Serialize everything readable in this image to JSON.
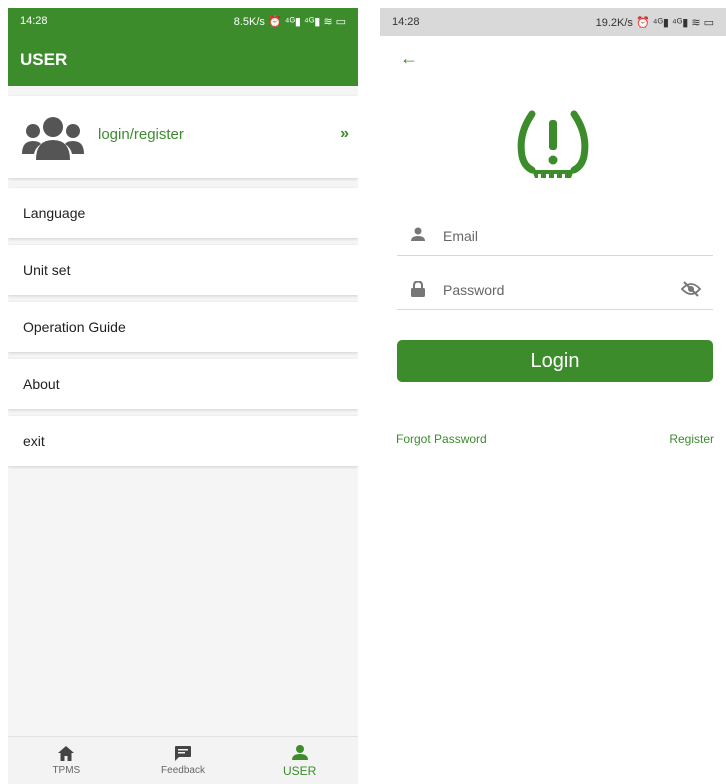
{
  "colors": {
    "primary": "#3c8c2c",
    "status_bar_right": "#d9d9d9",
    "background_left": "#f5f5f5"
  },
  "left": {
    "status_bar": {
      "time": "14:28",
      "info": "8.5K/s ⏰ ⁴ᴳ▮ ⁴ᴳ▮ ≋ ▭"
    },
    "appbar_title": "USER",
    "profile": {
      "avatar_icon": "group-icon",
      "label": "login/register",
      "chevron": "»"
    },
    "menu": [
      {
        "label": "Language"
      },
      {
        "label": "Unit set"
      },
      {
        "label": "Operation Guide"
      },
      {
        "label": "About"
      },
      {
        "label": "exit"
      }
    ],
    "bottom_nav": [
      {
        "label": "TPMS",
        "icon": "home-icon"
      },
      {
        "label": "Feedback",
        "icon": "feedback-icon"
      },
      {
        "label": "USER",
        "icon": "person-icon",
        "active": true
      }
    ]
  },
  "right": {
    "status_bar": {
      "time": "14:28",
      "info": "19.2K/s ⏰ ⁴ᴳ▮ ⁴ᴳ▮ ≋ ▭"
    },
    "back_icon": "←",
    "logo_icon": "tpms-warning-icon",
    "email": {
      "placeholder": "Email",
      "value": ""
    },
    "password": {
      "placeholder": "Password",
      "value": ""
    },
    "login_button": "Login",
    "forgot_password": "Forgot Password",
    "register": "Register"
  }
}
